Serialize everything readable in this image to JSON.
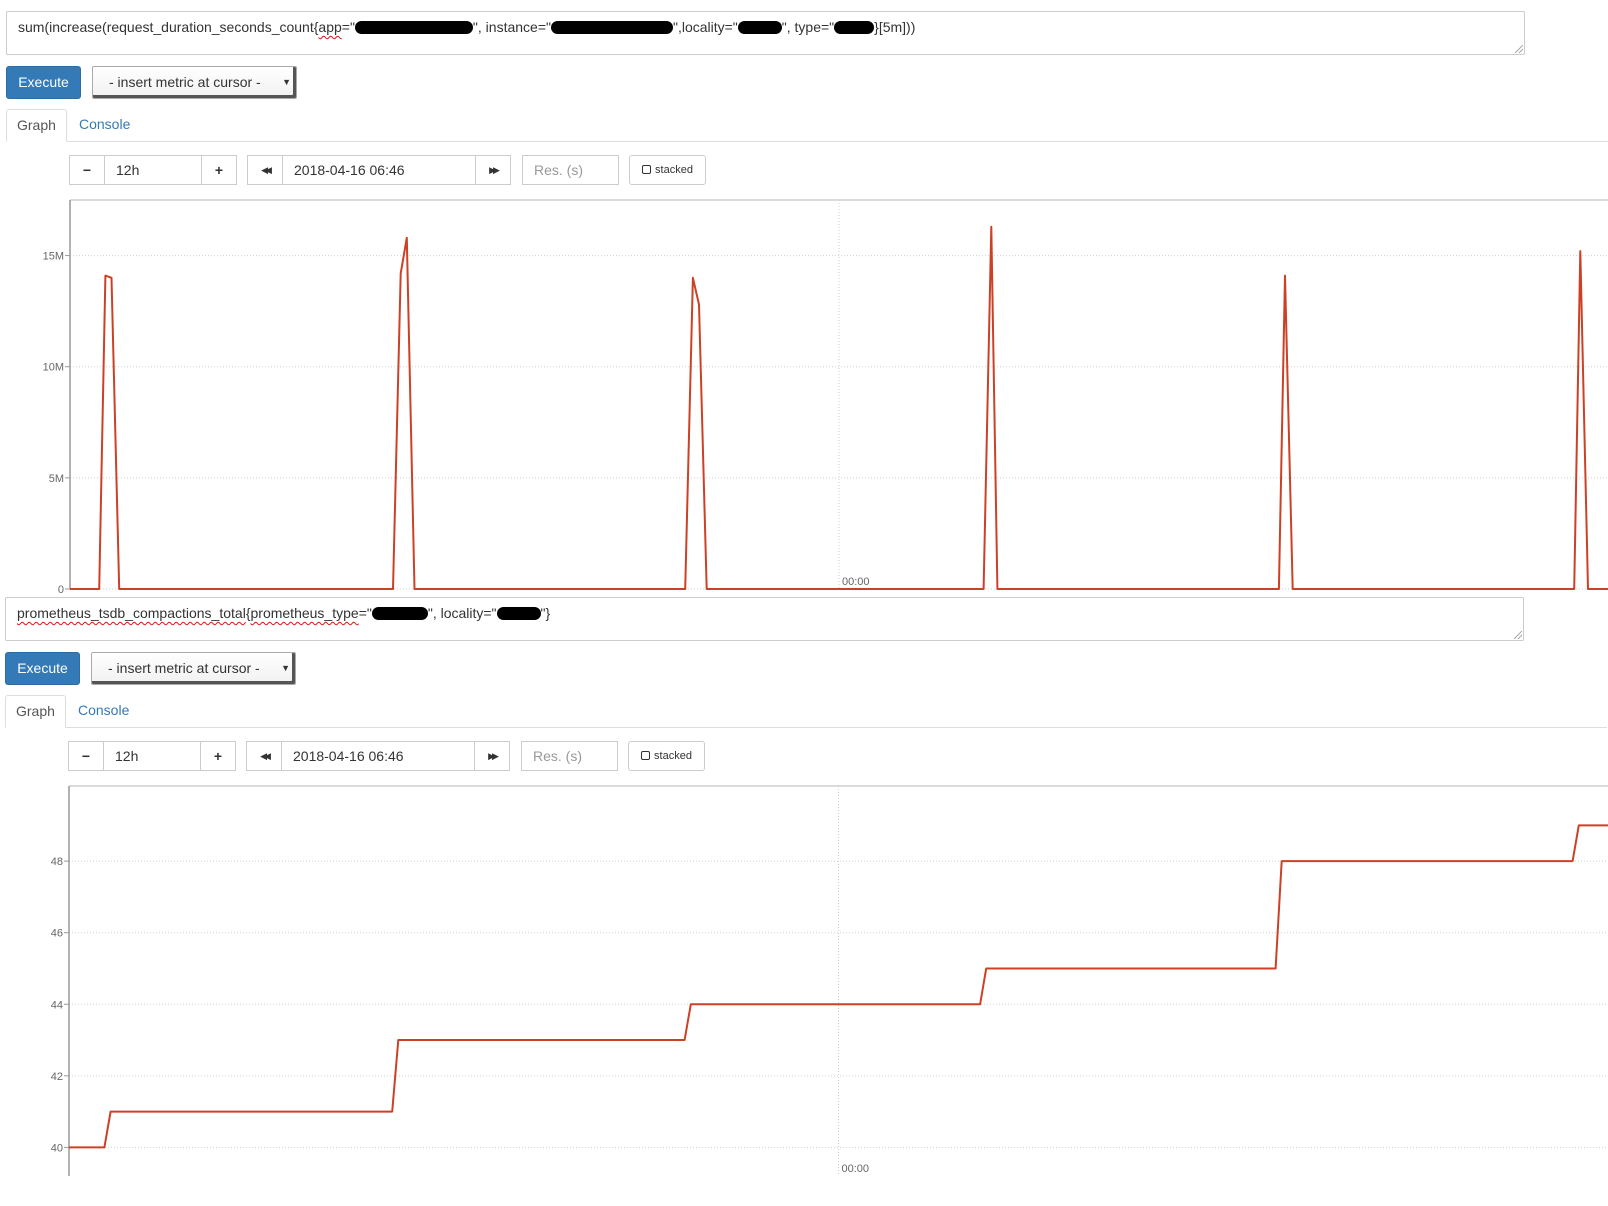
{
  "panels": [
    {
      "expression": {
        "parts": [
          {
            "t": "sum(increase(request_duration_seconds_count{"
          },
          {
            "t": "app",
            "squiggle": true
          },
          {
            "t": "=\""
          },
          {
            "redact": 118
          },
          {
            "t": "\", instance=\""
          },
          {
            "redact": 122
          },
          {
            "t": "\",locality=\""
          },
          {
            "redact": 44
          },
          {
            "t": "\", type=\""
          },
          {
            "redact": 40
          },
          {
            "t": "}[5m]))"
          }
        ]
      },
      "execute_label": "Execute",
      "insert_metric_label": "- insert metric at cursor -",
      "tabs": {
        "graph": "Graph",
        "console": "Console"
      },
      "controls": {
        "minus": "−",
        "range": "12h",
        "plus": "+",
        "back": "◀◀",
        "end_time": "2018-04-16 06:46",
        "forward": "▶▶",
        "res_placeholder": "Res. (s)",
        "stacked_label": "stacked"
      },
      "chart_data": {
        "type": "line",
        "color": "#cc4125",
        "ylim": [
          0,
          17500000
        ],
        "yticks": [
          {
            "v": 0,
            "label": "0"
          },
          {
            "v": 5000000,
            "label": "5M"
          },
          {
            "v": 10000000,
            "label": "10M"
          },
          {
            "v": 15000000,
            "label": "15M"
          }
        ],
        "xlim": [
          0,
          1000
        ],
        "xticks": [
          {
            "v": 500,
            "label": "00:00"
          }
        ],
        "series": [
          {
            "points": [
              [
                0,
                0
              ],
              [
                19,
                0
              ],
              [
                23,
                14100000
              ],
              [
                27,
                14000000
              ],
              [
                32,
                0
              ],
              [
                210,
                0
              ],
              [
                215,
                14200000
              ],
              [
                219,
                15800000
              ],
              [
                224,
                0
              ],
              [
                400,
                0
              ],
              [
                405,
                14000000
              ],
              [
                409,
                12800000
              ],
              [
                414,
                0
              ],
              [
                594,
                0
              ],
              [
                599,
                16300000
              ],
              [
                603,
                0
              ],
              [
                786,
                0
              ],
              [
                790,
                14100000
              ],
              [
                795,
                0
              ],
              [
                978,
                0
              ],
              [
                982,
                15200000
              ],
              [
                987,
                0
              ],
              [
                1000,
                0
              ]
            ]
          }
        ]
      }
    },
    {
      "expression": {
        "parts": [
          {
            "t": "prometheus_tsdb_compactions_total",
            "squiggle": true
          },
          {
            "t": "{"
          },
          {
            "t": "prometheus_type",
            "squiggle": true
          },
          {
            "t": "=\""
          },
          {
            "redact": 56
          },
          {
            "t": "\", locality=\""
          },
          {
            "redact": 44
          },
          {
            "t": "\"}"
          }
        ]
      },
      "execute_label": "Execute",
      "insert_metric_label": "- insert metric at cursor -",
      "tabs": {
        "graph": "Graph",
        "console": "Console"
      },
      "controls": {
        "minus": "−",
        "range": "12h",
        "plus": "+",
        "back": "◀◀",
        "end_time": "2018-04-16 06:46",
        "forward": "▶▶",
        "res_placeholder": "Res. (s)",
        "stacked_label": "stacked"
      },
      "chart_data": {
        "type": "line",
        "color": "#cc4125",
        "ylim": [
          39.2,
          50.1
        ],
        "yticks": [
          {
            "v": 40,
            "label": "40"
          },
          {
            "v": 42,
            "label": "42"
          },
          {
            "v": 44,
            "label": "44"
          },
          {
            "v": 46,
            "label": "46"
          },
          {
            "v": 48,
            "label": "48"
          }
        ],
        "xlim": [
          0,
          1000
        ],
        "xticks": [
          {
            "v": 500,
            "label": "00:00"
          }
        ],
        "series": [
          {
            "points": [
              [
                0,
                40
              ],
              [
                23,
                40
              ],
              [
                27,
                41
              ],
              [
                210,
                41
              ],
              [
                214,
                43
              ],
              [
                400,
                43
              ],
              [
                404,
                44
              ],
              [
                592,
                44
              ],
              [
                596,
                45
              ],
              [
                784,
                45
              ],
              [
                788,
                48
              ],
              [
                977,
                48
              ],
              [
                981,
                49
              ],
              [
                1000,
                49
              ]
            ]
          }
        ]
      }
    }
  ]
}
